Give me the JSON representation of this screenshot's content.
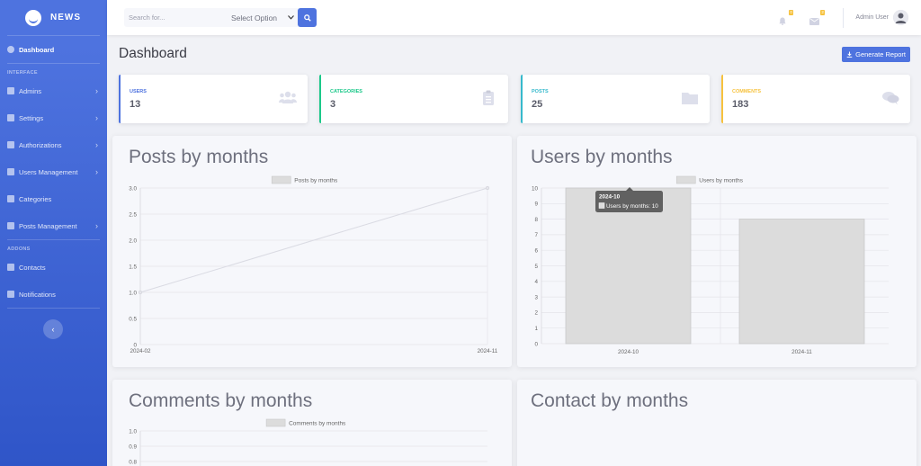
{
  "brand": {
    "name": "NEWS"
  },
  "sidebar": {
    "dashboard": "Dashboard",
    "heading_interface": "INTERFACE",
    "heading_addons": "ADDONS",
    "items": [
      {
        "label": "Admins",
        "icon": "user-shield-icon",
        "chevron": true
      },
      {
        "label": "Settings",
        "icon": "cogs-icon",
        "chevron": true
      },
      {
        "label": "Authorizations",
        "icon": "wrench-icon",
        "chevron": true
      },
      {
        "label": "Users Management",
        "icon": "users-icon",
        "chevron": true
      },
      {
        "label": "Categories",
        "icon": "table-icon",
        "chevron": false
      },
      {
        "label": "Posts Management",
        "icon": "folder-icon",
        "chevron": true
      }
    ],
    "addons": [
      {
        "label": "Contacts",
        "icon": "address-book-icon"
      },
      {
        "label": "Notifications",
        "icon": "bell-icon"
      }
    ]
  },
  "topbar": {
    "search_placeholder": "Search for...",
    "select_value": "Select Option",
    "alerts_count": "0",
    "messages_count": "2",
    "user_name": "Admin User"
  },
  "page": {
    "title": "Dashboard",
    "generate_label": "Generate Report"
  },
  "stats": [
    {
      "label": "USERS",
      "value": "13",
      "color": "#4e73df",
      "icon": "users-icon"
    },
    {
      "label": "CATEGORIES",
      "value": "3",
      "color": "#1cc88a",
      "icon": "clipboard-list-icon"
    },
    {
      "label": "POSTS",
      "value": "25",
      "color": "#36b9cc",
      "icon": "folder-icon"
    },
    {
      "label": "COMMENTS",
      "value": "183",
      "color": "#f6c23e",
      "icon": "comments-icon"
    }
  ],
  "charts": {
    "posts_title": "Posts by months",
    "users_title": "Users by months",
    "comments_title": "Comments by months",
    "contact_title": "Contact by months"
  },
  "chart_data": [
    {
      "type": "line",
      "title": "Posts by months",
      "series": [
        {
          "name": "Posts by months",
          "x": [
            "2024-02",
            "2024-11"
          ],
          "values": [
            1,
            3
          ]
        }
      ],
      "x": [
        "2024-02",
        "2024-11"
      ],
      "ylim": [
        0,
        3.0
      ],
      "yticks": [
        "0",
        "0.5",
        "1.0",
        "1.5",
        "2.0",
        "2.5",
        "3.0"
      ],
      "grid": true,
      "legend": "top"
    },
    {
      "type": "bar",
      "title": "Users by months",
      "categories": [
        "2024-10",
        "2024-11"
      ],
      "series": [
        {
          "name": "Users by months",
          "values": [
            10,
            8
          ]
        }
      ],
      "ylim": [
        0,
        10
      ],
      "yticks": [
        "0",
        "1",
        "2",
        "3",
        "4",
        "5",
        "6",
        "7",
        "8",
        "9",
        "10"
      ],
      "grid": true,
      "legend": "top",
      "tooltip": {
        "title": "2024-10",
        "text": "Users by months: 10"
      }
    },
    {
      "type": "line",
      "title": "Comments by months",
      "series": [
        {
          "name": "Comments by months",
          "values": []
        }
      ],
      "yticks_visible": [
        "1.0",
        "0.9",
        "0.8"
      ],
      "grid": true,
      "legend": "top"
    }
  ],
  "colors": {
    "primary": "#4e73df",
    "chart_fill": "#dcdcdc",
    "chart_stroke": "#c8c8c8"
  }
}
